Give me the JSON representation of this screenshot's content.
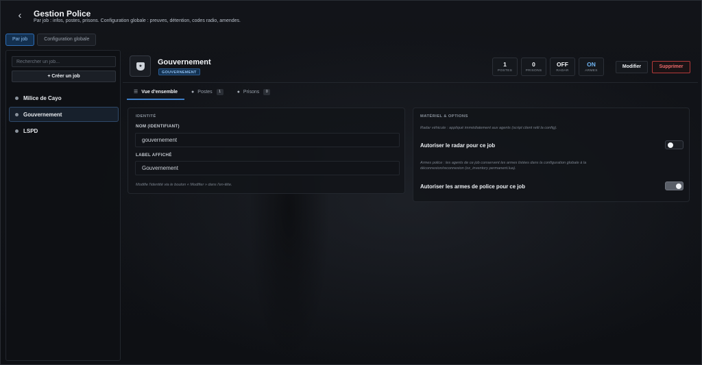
{
  "header": {
    "title": "Gestion Police",
    "subtitle": "Par job : infos, postes, prisons. Configuration globale : preuves, détention, codes radio, amendes.",
    "back_icon": "chevron-left-icon"
  },
  "top_tabs": [
    {
      "label": "Par job",
      "active": true
    },
    {
      "label": "Configuration globale",
      "active": false
    }
  ],
  "sidebar": {
    "search_placeholder": "Rechercher un job...",
    "create_label": "+ Créer un job",
    "jobs": [
      {
        "label": "Milice de Cayo",
        "selected": false
      },
      {
        "label": "Gouvernement",
        "selected": true
      },
      {
        "label": "LSPD",
        "selected": false
      }
    ]
  },
  "job": {
    "name": "Gouvernement",
    "tag": "GOUVERNEMENT",
    "badge_icon": "police-badge-icon",
    "stats": [
      {
        "value": "1",
        "label": "POSTES"
      },
      {
        "value": "0",
        "label": "PRISONS"
      },
      {
        "value": "OFF",
        "label": "RADAR"
      },
      {
        "value": "ON",
        "label": "ARMES"
      }
    ],
    "modify_label": "Modifier",
    "delete_label": "Supprimer"
  },
  "sub_tabs": [
    {
      "label": "Vue d'ensemble",
      "icon": "sliders-icon",
      "count": null,
      "active": true
    },
    {
      "label": "Postes",
      "icon": "location-pin-icon",
      "count": "1",
      "active": false
    },
    {
      "label": "Prisons",
      "icon": "location-pin-icon",
      "count": "0",
      "active": false
    }
  ],
  "identity": {
    "section_title": "IDENTITÉ",
    "name_label": "NOM (IDENTIFIANT)",
    "name_value": "gouvernement",
    "display_label": "LABEL AFFICHÉ",
    "display_value": "Gouvernement",
    "hint": "Modifie l'identité via le bouton « Modifier » dans l'en-tête."
  },
  "options": {
    "section_title": "MATÉRIEL & OPTIONS",
    "radar_hint": "Radar véhicule : appliqué immédiatement aux agents (script client relit la config).",
    "radar_label": "Autoriser le radar pour ce job",
    "radar_on": false,
    "weapons_hint_1": "Armes police : les agents de ce job conservent les armes listées dans la configuration globale à la",
    "weapons_hint_2": "déconnexion/reconnexion (ox_inventory permanent.lua).",
    "weapons_label": "Autoriser les armes de police pour ce job",
    "weapons_on": true
  },
  "colors": {
    "accent": "#3d7fc9",
    "danger": "#ef6b6b",
    "background": "#0f1115"
  }
}
